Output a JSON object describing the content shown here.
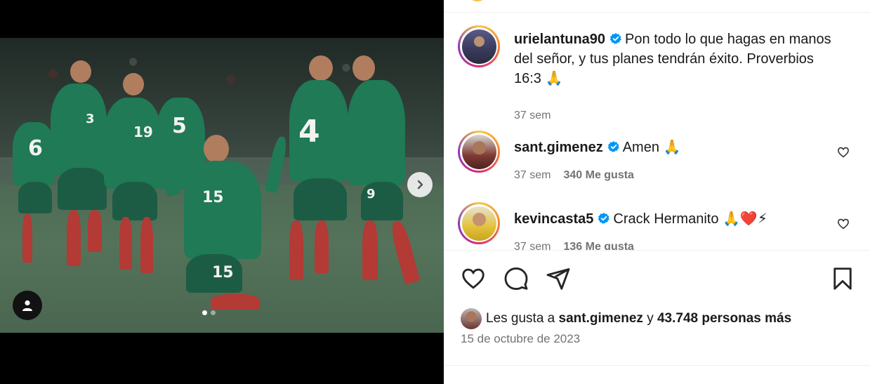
{
  "post": {
    "carousel_total": 2,
    "carousel_index": 1
  },
  "comments": [
    {
      "username": "urielantuna90",
      "verified": true,
      "text": "Pon todo lo que hagas en manos del señor, y tus planes tendrán éxito. Proverbios 16:3 🙏",
      "time": "37 sem",
      "likes": ""
    },
    {
      "username": "sant.gimenez",
      "verified": true,
      "text": "Amen 🙏",
      "time": "37 sem",
      "likes": "340 Me gusta"
    },
    {
      "username": "kevincasta5",
      "verified": true,
      "text": "Crack Hermanito 🙏❤️⚡",
      "time": "37 sem",
      "likes": "136 Me gusta"
    }
  ],
  "likes_summary": {
    "prefix": "Les gusta a",
    "user": "sant.gimenez",
    "connector": "y",
    "others": "43.748 personas más"
  },
  "date": "15 de octubre de 2023",
  "colors": {
    "verified_badge": "#0095f6",
    "meta_gray": "#737373",
    "jersey_green": "#1f7a55"
  },
  "icons": {
    "like": "heart-icon",
    "comment": "comment-bubble-icon",
    "share": "paper-plane-icon",
    "save": "bookmark-icon"
  }
}
